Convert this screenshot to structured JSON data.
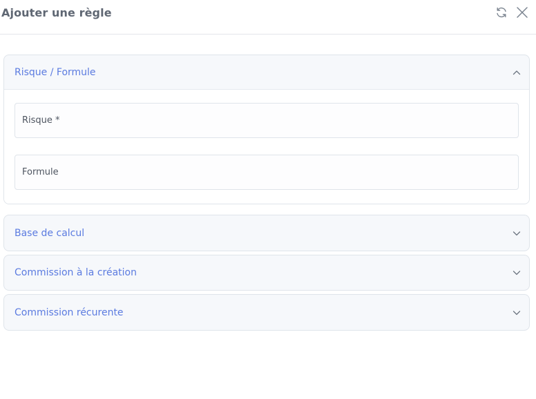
{
  "dialog": {
    "title": "Ajouter une règle",
    "icons": {
      "refresh": "refresh-icon",
      "close": "close-icon"
    }
  },
  "sections": [
    {
      "title": "Risque / Formule",
      "expanded": true,
      "fields": [
        {
          "label": "Risque *"
        },
        {
          "label": "Formule"
        }
      ]
    },
    {
      "title": "Base de calcul",
      "expanded": false
    },
    {
      "title": "Commission à la création",
      "expanded": false
    },
    {
      "title": "Commission récurente",
      "expanded": false
    }
  ],
  "colors": {
    "accent": "#5b7be0",
    "title": "#5f6773",
    "border": "#dfe4ea",
    "panel_bg": "#f6f8fb"
  }
}
